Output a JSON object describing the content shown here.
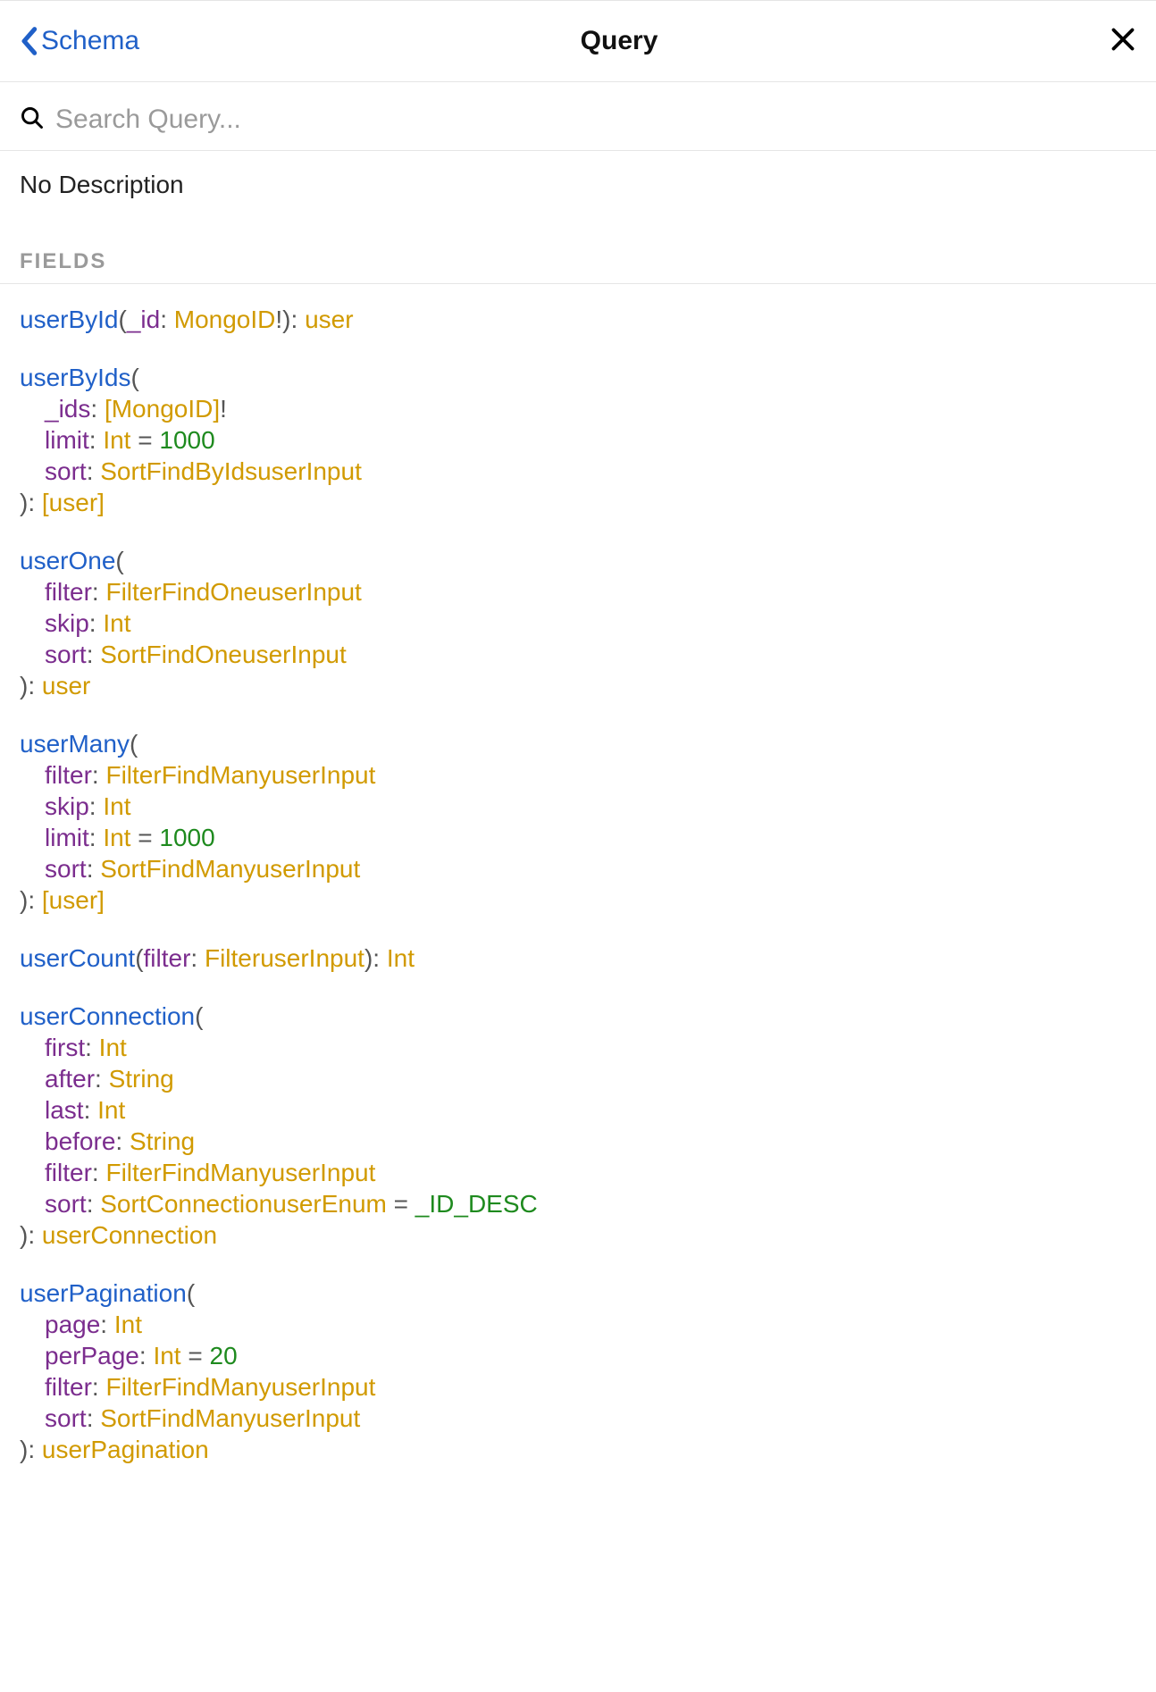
{
  "header": {
    "back_label": "Schema",
    "title": "Query"
  },
  "search": {
    "placeholder": "Search Query..."
  },
  "description": "No Description",
  "section_label": "FIELDS",
  "fields": [
    {
      "name": "userById",
      "args": [
        {
          "name": "_id",
          "type": "MongoID",
          "non_null": true
        }
      ],
      "inline": true,
      "return_type": "user"
    },
    {
      "name": "userByIds",
      "args": [
        {
          "name": "_ids",
          "type": "MongoID",
          "list": true,
          "non_null": true
        },
        {
          "name": "limit",
          "type": "Int",
          "default": "1000"
        },
        {
          "name": "sort",
          "type": "SortFindByIdsuserInput"
        }
      ],
      "return_type": "user",
      "return_list": true
    },
    {
      "name": "userOne",
      "args": [
        {
          "name": "filter",
          "type": "FilterFindOneuserInput"
        },
        {
          "name": "skip",
          "type": "Int"
        },
        {
          "name": "sort",
          "type": "SortFindOneuserInput"
        }
      ],
      "return_type": "user"
    },
    {
      "name": "userMany",
      "args": [
        {
          "name": "filter",
          "type": "FilterFindManyuserInput"
        },
        {
          "name": "skip",
          "type": "Int"
        },
        {
          "name": "limit",
          "type": "Int",
          "default": "1000"
        },
        {
          "name": "sort",
          "type": "SortFindManyuserInput"
        }
      ],
      "return_type": "user",
      "return_list": true
    },
    {
      "name": "userCount",
      "args": [
        {
          "name": "filter",
          "type": "FilteruserInput"
        }
      ],
      "inline": true,
      "return_type": "Int"
    },
    {
      "name": "userConnection",
      "args": [
        {
          "name": "first",
          "type": "Int"
        },
        {
          "name": "after",
          "type": "String"
        },
        {
          "name": "last",
          "type": "Int"
        },
        {
          "name": "before",
          "type": "String"
        },
        {
          "name": "filter",
          "type": "FilterFindManyuserInput"
        },
        {
          "name": "sort",
          "type": "SortConnectionuserEnum",
          "default": "_ID_DESC"
        }
      ],
      "return_type": "userConnection"
    },
    {
      "name": "userPagination",
      "args": [
        {
          "name": "page",
          "type": "Int"
        },
        {
          "name": "perPage",
          "type": "Int",
          "default": "20"
        },
        {
          "name": "filter",
          "type": "FilterFindManyuserInput"
        },
        {
          "name": "sort",
          "type": "SortFindManyuserInput"
        }
      ],
      "return_type": "userPagination"
    }
  ]
}
